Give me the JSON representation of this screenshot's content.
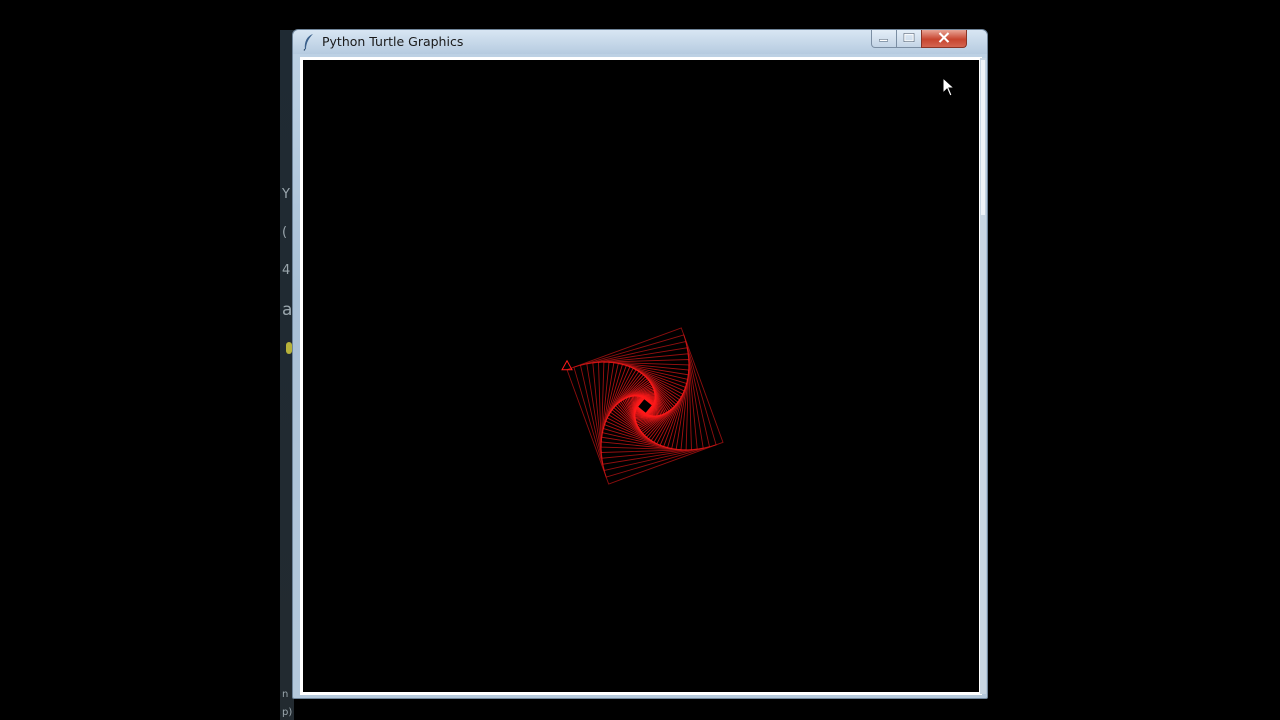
{
  "window": {
    "title": "Python Turtle Graphics",
    "icons": {
      "app": "feather-icon",
      "minimize": "minimize-icon",
      "maximize": "maximize-icon",
      "close": "close-icon",
      "cursor": "mouse-pointer-icon"
    }
  },
  "background_app": {
    "glyphs": [
      "Y",
      "(",
      "4",
      "a",
      "n",
      "p)"
    ]
  },
  "canvas": {
    "background": "#000000",
    "pen_color": "#ff1a1a",
    "drawing": "square-spiral-pattern"
  }
}
